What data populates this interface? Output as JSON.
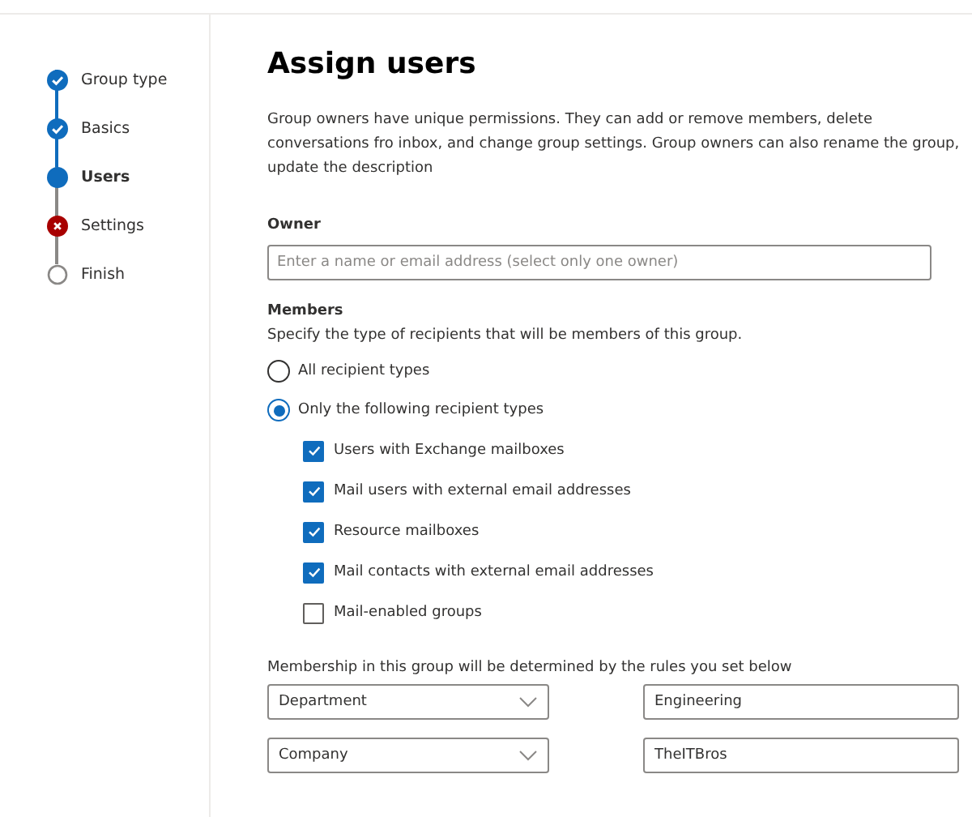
{
  "steps": [
    {
      "label": "Group type",
      "kind": "done"
    },
    {
      "label": "Basics",
      "kind": "done"
    },
    {
      "label": "Users",
      "kind": "current"
    },
    {
      "label": "Settings",
      "kind": "error"
    },
    {
      "label": "Finish",
      "kind": "pending"
    }
  ],
  "title": "Assign users",
  "description": "Group owners have unique permissions. They can add or remove members, delete conversations fro inbox, and change group settings. Group owners can also rename the group, update the description",
  "owner": {
    "label": "Owner",
    "placeholder": "Enter a name or email address (select only one owner)"
  },
  "members": {
    "label": "Members",
    "hint": "Specify the type of recipients that will be members of this group.",
    "options": [
      {
        "label": "All recipient types",
        "selected": false
      },
      {
        "label": "Only the following recipient types",
        "selected": true
      }
    ],
    "types": [
      {
        "label": "Users with Exchange mailboxes",
        "checked": true
      },
      {
        "label": "Mail users with external email addresses",
        "checked": true
      },
      {
        "label": "Resource mailboxes",
        "checked": true
      },
      {
        "label": "Mail contacts with external email addresses",
        "checked": true
      },
      {
        "label": "Mail-enabled groups",
        "checked": false
      }
    ]
  },
  "rules": {
    "label": "Membership in this group will be determined by the rules you set below",
    "rows": [
      {
        "attribute": "Department",
        "value": "Engineering"
      },
      {
        "attribute": "Company",
        "value": "TheITBros"
      }
    ]
  }
}
